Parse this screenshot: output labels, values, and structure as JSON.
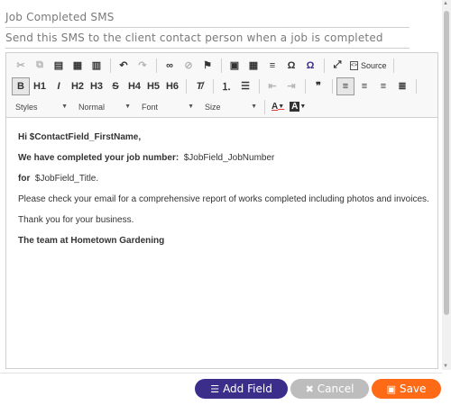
{
  "form": {
    "name": "Job Completed SMS",
    "description": "Send this SMS to the client contact person when a job is completed"
  },
  "toolbar": {
    "source_label": "Source",
    "format_buttons": [
      "B",
      "H1",
      "I",
      "H2",
      "H3",
      "S",
      "H4",
      "H5",
      "H6"
    ],
    "styles_label": "Styles",
    "format_label": "Normal",
    "font_label": "Font",
    "size_label": "Size",
    "text_color_label": "A",
    "bg_color_label": "A"
  },
  "content": {
    "line1": "Hi $ContactField_FirstName,",
    "line2_bold": "We have completed your job number:",
    "line2_rest": "$JobField_JobNumber",
    "line3_bold": "for",
    "line3_rest": "$JobField_Title.",
    "line4": "Please check your email for a comprehensive report of works completed including photos and invoices.",
    "line5": "Thank you for your business.",
    "line6": "The team at Hometown Gardening"
  },
  "footer": {
    "add_field_label": "Add Field",
    "cancel_label": "Cancel",
    "save_label": "Save"
  },
  "colors": {
    "add_field": "#3b2e8a",
    "cancel": "#bdbdbd",
    "save": "#ff6a16"
  }
}
